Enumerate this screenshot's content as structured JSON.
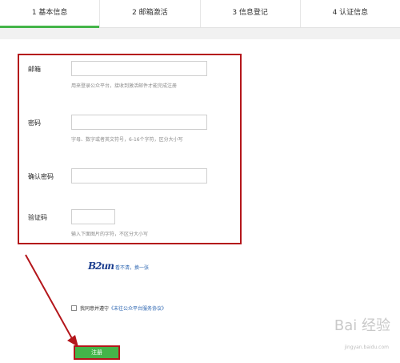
{
  "steps": [
    {
      "label": "1 基本信息"
    },
    {
      "label": "2 邮箱激活"
    },
    {
      "label": "3 信息登记"
    },
    {
      "label": "4 认证信息"
    }
  ],
  "form": {
    "email": {
      "label": "邮箱",
      "value": "",
      "placeholder": "",
      "hint": "用来登录公众平台，接收到激活邮件才能完成注册"
    },
    "password": {
      "label": "密码",
      "value": "",
      "placeholder": "",
      "hint": "字母、数字或者英文符号，6-16个字符，区分大小写"
    },
    "confirm_password": {
      "label": "确认密码",
      "value": "",
      "placeholder": ""
    },
    "captcha": {
      "label": "验证码",
      "value": "",
      "placeholder": "",
      "hint": "输入下面图片的字符，不区分大小写"
    }
  },
  "captcha_image": {
    "text": "B2un",
    "refresh_label": "看不清，换一张"
  },
  "agreement": {
    "prefix": "我同意并遵守",
    "link": "《未往公众平台服务协议》",
    "checked": false
  },
  "register_button": {
    "label": "注册"
  },
  "watermark": {
    "text": "Bai 经验",
    "sub": "jingyan.baidu.com"
  },
  "colors": {
    "accent": "#44b549",
    "highlight_red": "#b4161b",
    "link": "#2a64b0"
  }
}
